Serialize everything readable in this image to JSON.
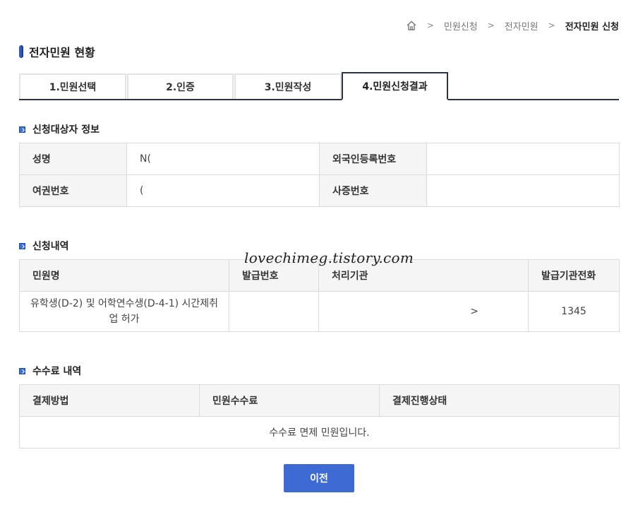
{
  "breadcrumb": {
    "items": [
      "민원신청",
      "전자민원"
    ],
    "current": "전자민원 신청"
  },
  "page_title": "전자민원 현황",
  "tabs": [
    {
      "label": "1.민원선택",
      "active": false
    },
    {
      "label": "2.인증",
      "active": false
    },
    {
      "label": "3.민원작성",
      "active": false
    },
    {
      "label": "4.민원신청결과",
      "active": true
    }
  ],
  "applicant": {
    "section_title": "신청대상자 정보",
    "name_label": "성명",
    "name_value": "N(",
    "alien_reg_label": "외국인등록번호",
    "alien_reg_value": "",
    "passport_label": "여권번호",
    "passport_value": "(",
    "business_label": "사증번호",
    "business_value": ""
  },
  "application": {
    "section_title": "신청내역",
    "headers": [
      "민원명",
      "발급번호",
      "처리기관",
      "발급기관전화"
    ],
    "row": {
      "name": "유학생(D-2) 및 어학연수생(D-4-1) 시간제취업 허가",
      "issue_no": "",
      "agency": ">",
      "phone": "1345"
    }
  },
  "watermark": "lovechimeg.tistory.com",
  "fee": {
    "section_title": "수수료 내역",
    "headers": [
      "결제방법",
      "민원수수료",
      "결제진행상태"
    ],
    "message": "수수료 면제 민원입니다."
  },
  "buttons": {
    "prev_label": "이전"
  },
  "colors": {
    "accent": "#3e6bd3",
    "tab_border": "#2b3543",
    "header_bg": "#f5f5f5"
  }
}
